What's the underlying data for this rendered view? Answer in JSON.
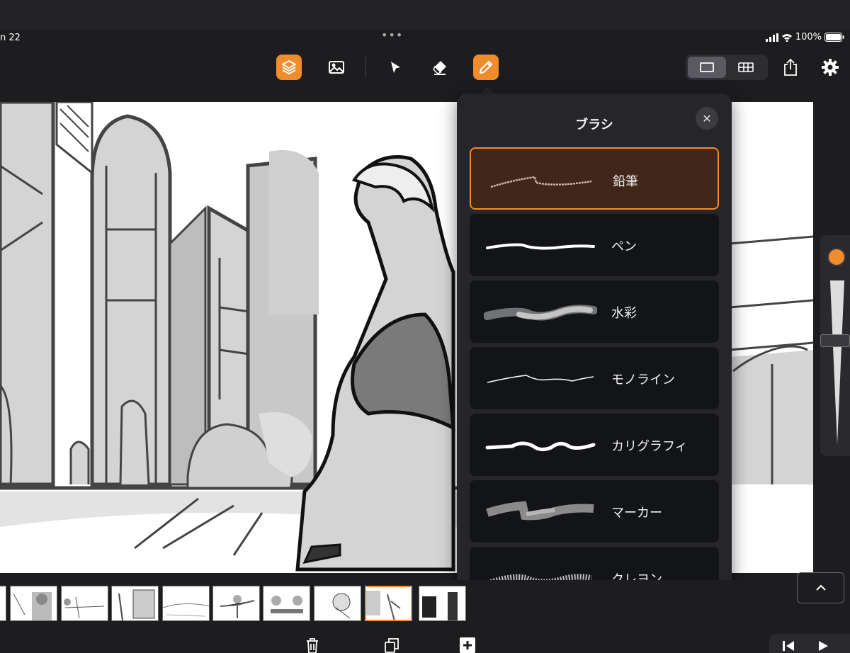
{
  "status": {
    "time": "n 22",
    "dots": "•••",
    "battery": "100%"
  },
  "brush_panel": {
    "title": "ブラシ",
    "close_glyph": "✕",
    "brushes": [
      {
        "label": "鉛筆",
        "selected": true
      },
      {
        "label": "ペン",
        "selected": false
      },
      {
        "label": "水彩",
        "selected": false
      },
      {
        "label": "モノライン",
        "selected": false
      },
      {
        "label": "カリグラフィ",
        "selected": false
      },
      {
        "label": "マーカー",
        "selected": false
      },
      {
        "label": "クレヨン",
        "selected": false
      }
    ]
  },
  "toolbar": {
    "icons": [
      "layers-icon",
      "image-icon",
      "select-arrow-icon",
      "eraser-icon",
      "pencil-icon",
      "single-view-icon",
      "grid-view-icon",
      "share-icon",
      "gear-icon"
    ],
    "active_tool": "pencil"
  },
  "colors": {
    "accent": "#f08c2c",
    "panel": "#26262a",
    "item": "#121418",
    "selected_item": "#41261a",
    "background": "#1d1d20"
  },
  "filmstrip": {
    "selected_index": 7,
    "count": 10
  },
  "bottom_bar": {
    "icons": [
      "trash-icon",
      "duplicate-icon",
      "add-icon",
      "skip-start-icon",
      "play-icon"
    ]
  }
}
